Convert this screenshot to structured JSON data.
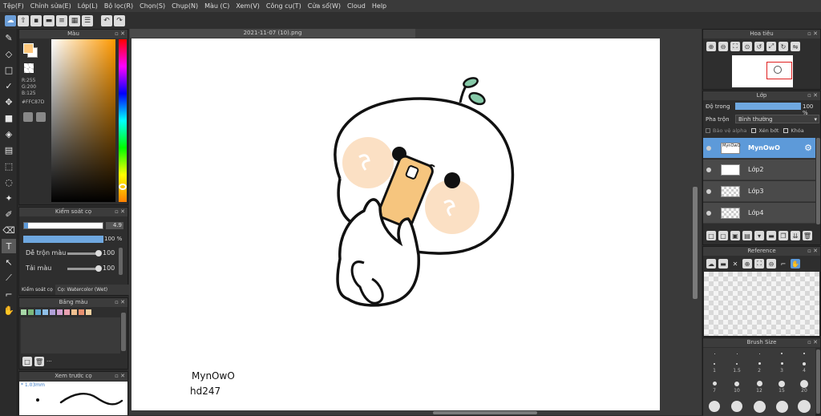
{
  "menu": [
    "Tệp(F)",
    "Chỉnh sửa(E)",
    "Lớp(L)",
    "Bộ lọc(R)",
    "Chọn(S)",
    "Chụp(N)",
    "Màu (C)",
    "Xem(V)",
    "Công cụ(T)",
    "Cửa sổ(W)",
    "Cloud",
    "Help"
  ],
  "document": {
    "title": "2021-11-07 (10).png"
  },
  "color_panel": {
    "title": "Màu",
    "r": "R:255",
    "g": "G:200",
    "b": "B:125",
    "hex": "#FFC87D",
    "fg_color": "#FFC87D",
    "bg_color": "#ffffff"
  },
  "brush_control": {
    "title": "Kiểm soát cọ",
    "size": "4.9",
    "opacity": "100 %",
    "blend_label": "Dễ trộn màu",
    "blend_value": "100",
    "tai_mau_label": "Tải màu",
    "tai_mau_value": "100",
    "tab1": "Kiểm soát cọ",
    "tab2": "Cọ: Watercolor (Wet)"
  },
  "palette": {
    "title": "Bảng màu",
    "colors": [
      "#a8d8a8",
      "#7cb87c",
      "#5fa8d0",
      "#8fc0e8",
      "#b0a0d8",
      "#d0a0d0",
      "#e8a0b0",
      "#f0c090",
      "#e89070",
      "#f0d0a0"
    ],
    "more": "···"
  },
  "brush_preview": {
    "title": "Xem trước cọ",
    "size": "1.03mm"
  },
  "canvas": {
    "text_line1": "MynOwO",
    "text_line2": "hd247"
  },
  "navigator": {
    "title": "Hoa tiêu"
  },
  "layers": {
    "title": "Lớp",
    "opacity_label": "Độ trong",
    "opacity_value": "100 %",
    "blend_label": "Pha trộn",
    "blend_value": "Bình thường",
    "protect_alpha": "Bảo vệ alpha",
    "clipping": "Xén bớt",
    "lock": "Khóa",
    "items": [
      {
        "name": "MynOwO",
        "active": true
      },
      {
        "name": "Lớp2",
        "active": false
      },
      {
        "name": "Lớp3",
        "active": false
      },
      {
        "name": "Lớp4",
        "active": false
      }
    ]
  },
  "reference": {
    "title": "Reference"
  },
  "brush_size": {
    "title": "Brush Size",
    "row1": [
      "1",
      "1.5",
      "2",
      "3",
      "4"
    ],
    "row2": [
      "7",
      "10",
      "12",
      "15",
      "20"
    ]
  }
}
